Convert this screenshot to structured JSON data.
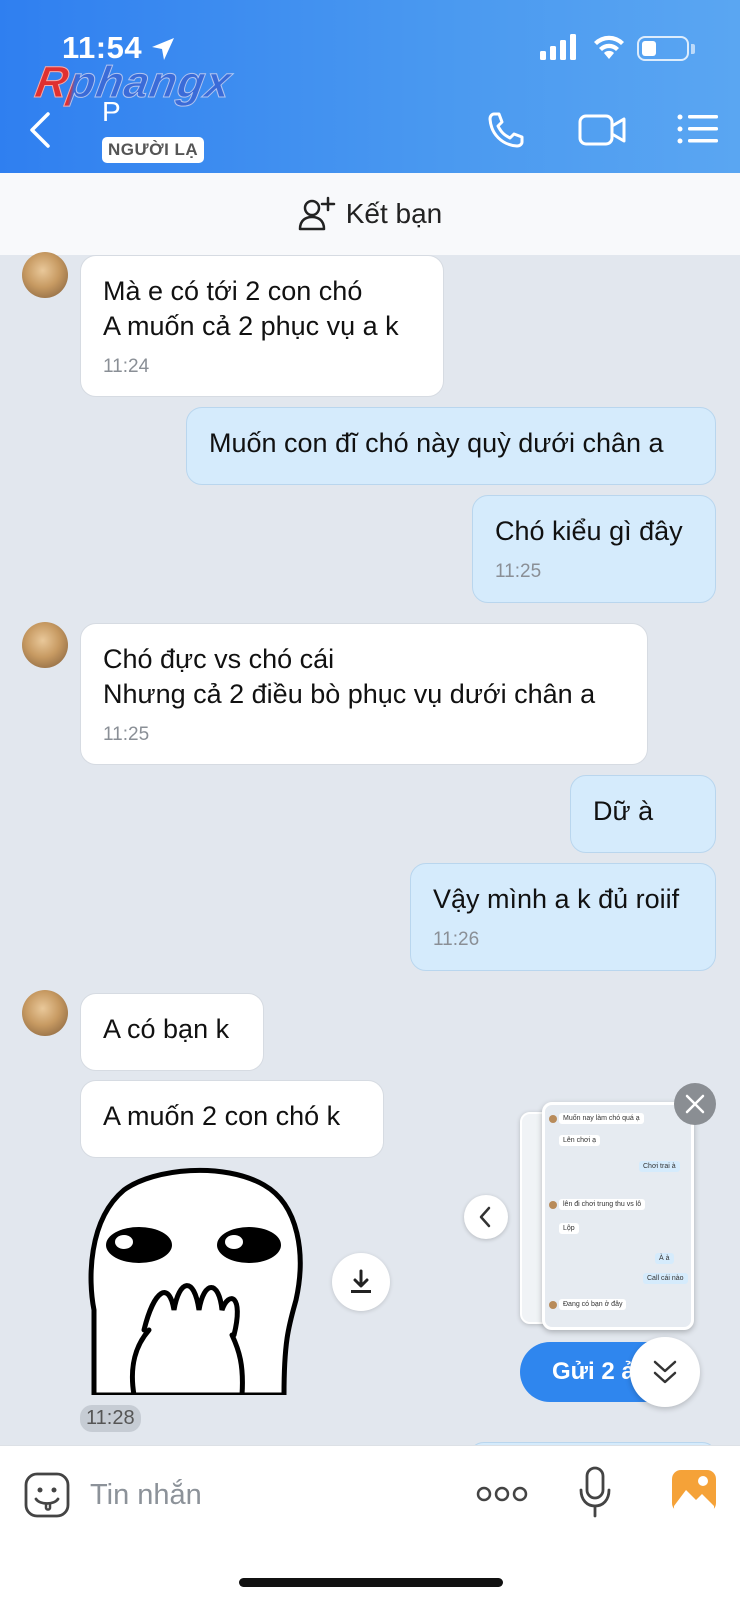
{
  "status_bar": {
    "time": "11:54"
  },
  "watermark": "Rphangx",
  "header": {
    "contact_name": "P",
    "stranger_badge": "NGƯỜI LẠ"
  },
  "add_friend_label": "Kết bạn",
  "messages": [
    {
      "dir": "in",
      "lines": "Mà e có tới 2 con chó\nA muốn cả 2 phục vụ a k",
      "time": "11:24"
    },
    {
      "dir": "out",
      "lines": "Muốn con đĩ chó này quỳ dưới chân a",
      "time": ""
    },
    {
      "dir": "out",
      "lines": "Chó kiểu gì đây",
      "time": "11:25"
    },
    {
      "dir": "in",
      "lines": "Chó đực vs chó cái\nNhưng cả 2 điều bò phục vụ dưới chân a",
      "time": "11:25"
    },
    {
      "dir": "out",
      "lines": "Dữ à",
      "time": ""
    },
    {
      "dir": "out",
      "lines": "Vậy mình a k đủ roiif",
      "time": "11:26"
    },
    {
      "dir": "in",
      "lines": "A có bạn k",
      "time": ""
    },
    {
      "dir": "in",
      "lines": "A muốn 2 con chó k",
      "time": ""
    }
  ],
  "sticker_time": "11:28",
  "preview": {
    "lines": [
      "Muốn nay làm chó quá ạ",
      "Lên chơi ạ",
      "Chơi trai à",
      "lên đi chơi trung thu vs lô",
      "Lộp",
      "À à",
      "Call cái nào",
      "Đang có bạn ở đây"
    ]
  },
  "send_button_label": "Gửi 2 ả",
  "input": {
    "placeholder": "Tin nhắn"
  }
}
